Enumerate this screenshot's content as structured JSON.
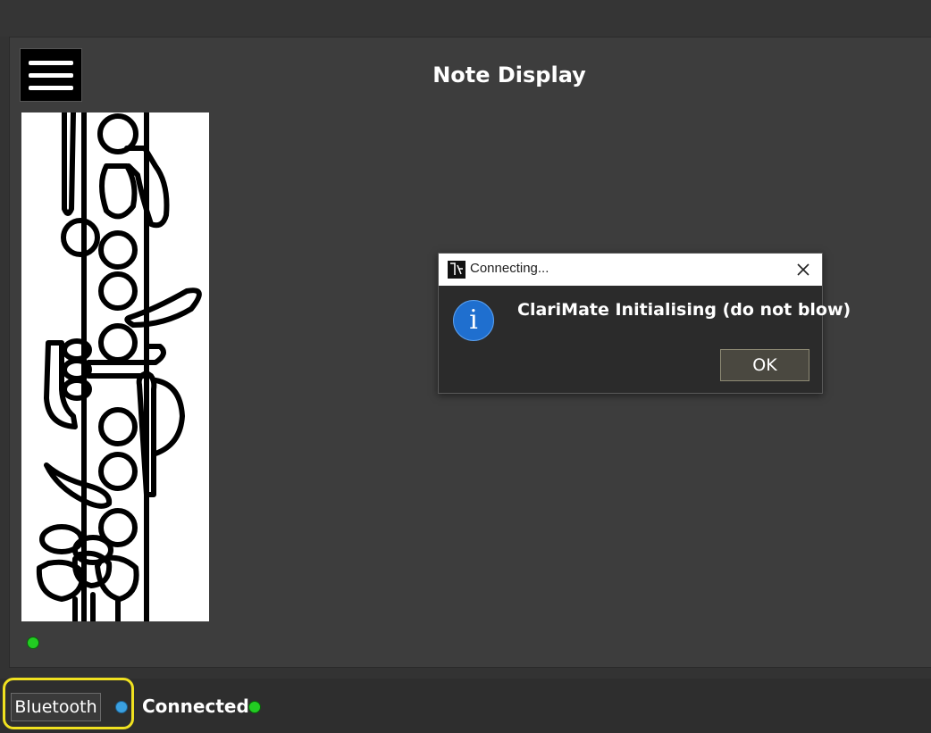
{
  "header": {
    "title": "Note Display"
  },
  "menu": {
    "icon": "hamburger-menu-icon"
  },
  "fingering_chart": {
    "icon": "clarinet-fingering-diagram"
  },
  "status": {
    "note_led_color": "#22cc22",
    "bluetooth_led_color": "#3aa0e0",
    "connected_led_color": "#22cc22"
  },
  "bottom_bar": {
    "bluetooth_label": "Bluetooth",
    "connected_label": "Connected",
    "highlight_color": "#f0e120"
  },
  "dialog": {
    "title": "Connecting...",
    "message": "ClariMate Initialising (do not blow)",
    "ok_label": "OK",
    "info_glyph": "i",
    "icon": "info-icon"
  }
}
